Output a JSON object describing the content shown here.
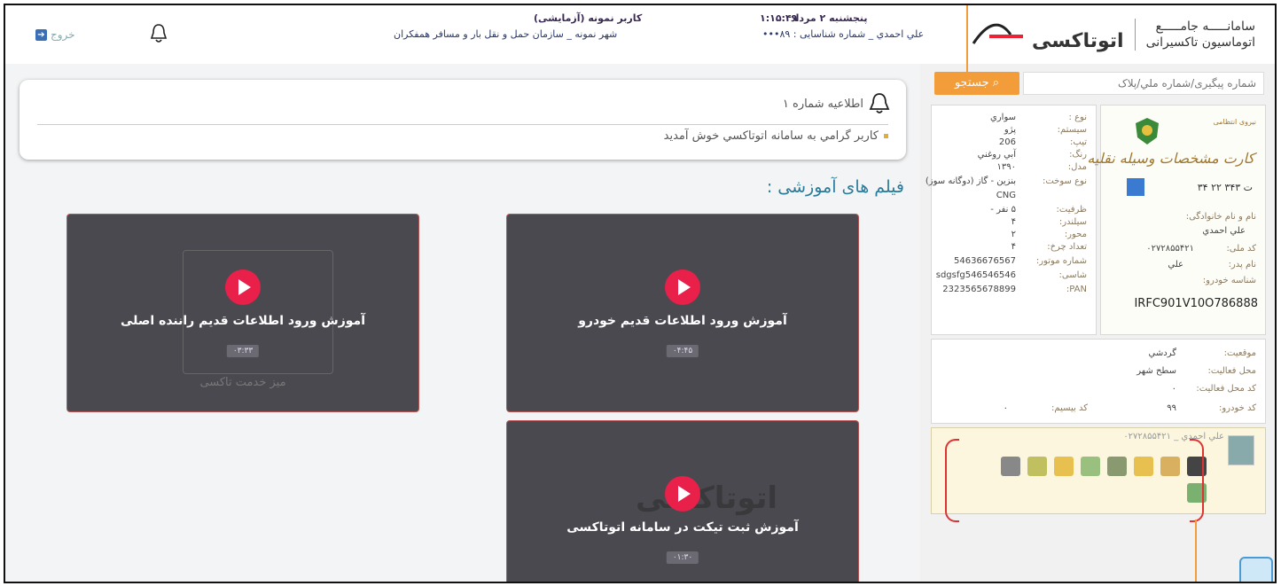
{
  "header": {
    "system_title_line1": "سامانـــــه جامـــــع",
    "system_title_line2": "اتوماسیون تاکسیرانی",
    "brand": "اتوتاکسی",
    "date": "پنجشنبه ۲ مرداد",
    "time": "۱:۱۵:۴۹",
    "user_id_line": "علي احمدي _ شماره شناسایی : ۸۹•••",
    "user_role": "کاربر نمونه (آزمایشی)",
    "org_line": "شهر نمونه _ سازمان حمل و نقل بار و مسافر همفکران",
    "exit_label": "خروج"
  },
  "notice": {
    "title": "اطلاعیه شماره ۱",
    "message": "کاربر گرامي به سامانه اتوتاکسي خوش آمدید"
  },
  "films": {
    "title": "فیلم های آموزشی :",
    "videos": [
      {
        "title": "آموزش ورود اطلاعات قدیم خودرو",
        "duration": "۰۴:۴۵"
      },
      {
        "title": "آموزش ورود اطلاعات قدیم راننده اصلی",
        "duration": "۰۳:۳۳",
        "subtitle": "میز خدمت تاکسی"
      },
      {
        "title": "آموزش ثبت تیکت در سامانه اتوتاکسی",
        "duration": "۰۱:۳۰",
        "brand": "اتوتاکسی"
      }
    ]
  },
  "search": {
    "placeholder": "شماره پیگیری/شماره ملي/پلاک",
    "button": "جستجو"
  },
  "vehicle_card": {
    "card_heading": "کارت مشخصات وسیله نقلیه",
    "plate": "۳۴ ت ۳۴۳ ۲۲",
    "name_label": "نام و نام خانوادگی:",
    "name_value": "علي احمدي",
    "national_label": "کد ملی:",
    "national_value": "۰۲۷۲۸۵۵۴۲۱",
    "father_label": "نام پدر:",
    "father_value": "علي",
    "vin_label": "شناسه خودرو:",
    "vin_value": "IRFC901V10O786888",
    "specs": [
      {
        "label": "نوع :",
        "value": "سواري"
      },
      {
        "label": "سیستم:",
        "value": "پژو"
      },
      {
        "label": "تیپ:",
        "value": "206"
      },
      {
        "label": "رنگ:",
        "value": "آبي روغني"
      },
      {
        "label": "مدل:",
        "value": "۱۳۹۰"
      },
      {
        "label": "نوع سوخت:",
        "value": "بنزین - گاز (دوگانه سوز)"
      },
      {
        "label": "",
        "value": "CNG"
      },
      {
        "label": "ظرفیت:",
        "value": "۵ نفر -"
      },
      {
        "label": "سیلندر:",
        "value": "۴"
      },
      {
        "label": "محور:",
        "value": "۲"
      },
      {
        "label": "تعداد چرخ:",
        "value": "۴"
      },
      {
        "label": "شماره موتور:",
        "value": "54636676567"
      },
      {
        "label": "شاسی:",
        "value": "sdgsfg546546546"
      },
      {
        "label": "PAN:",
        "value": "2323565678899"
      }
    ]
  },
  "activity": {
    "location_label": "موقعیت:",
    "location_value": "گردشي",
    "area_label": "محل فعالیت:",
    "area_value": "سطح شهر",
    "area_code_label": "کد محل فعالیت:",
    "area_code_value": "۰",
    "vehicle_code_label": "کد خودرو:",
    "vehicle_code_value": "۹۹",
    "wireless_label": "کد بیسیم:",
    "wireless_value": "۰"
  },
  "actions": {
    "user_line": "علي احمدي _ ۰۲۷۲۸۵۵۴۲۱",
    "icons": [
      "books-icon",
      "edit-form-icon",
      "taxi-upload-icon",
      "id-card-icon",
      "add-list-icon",
      "taxi-icon",
      "location-pin-icon",
      "document-icon",
      "money-help-icon"
    ]
  }
}
